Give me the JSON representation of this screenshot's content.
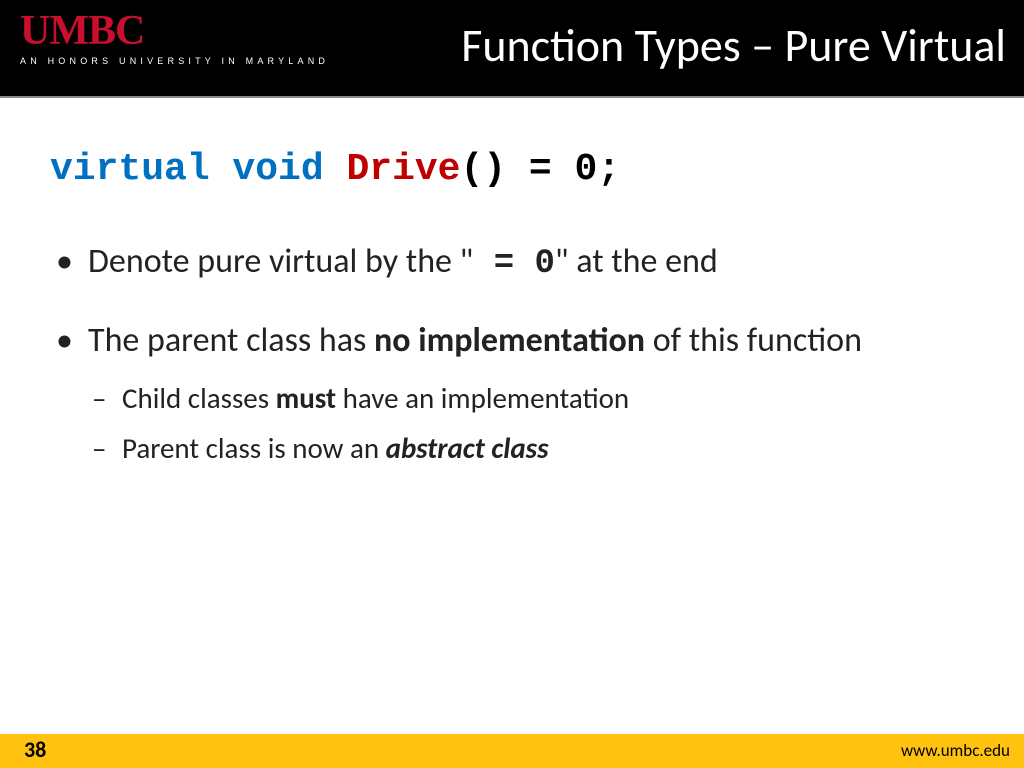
{
  "header": {
    "logo": "UMBC",
    "tagline": "AN HONORS UNIVERSITY IN MARYLAND",
    "title": "Function Types – Pure Virtual"
  },
  "code": {
    "keywords": "virtual void",
    "func": "Drive",
    "tail": "() = 0;"
  },
  "bullets": {
    "b1_pre": "Denote pure virtual by the \"",
    "b1_mono": " = 0",
    "b1_post": "\" at the end",
    "b2_pre": "The parent class has ",
    "b2_bold": "no implementation",
    "b2_post": " of this function",
    "s1_pre": "Child classes ",
    "s1_bold": "must",
    "s1_post": " have an implementation",
    "s2_pre": "Parent class is now an ",
    "s2_bi": "abstract class"
  },
  "footer": {
    "page": "38",
    "url": "www.umbc.edu"
  }
}
